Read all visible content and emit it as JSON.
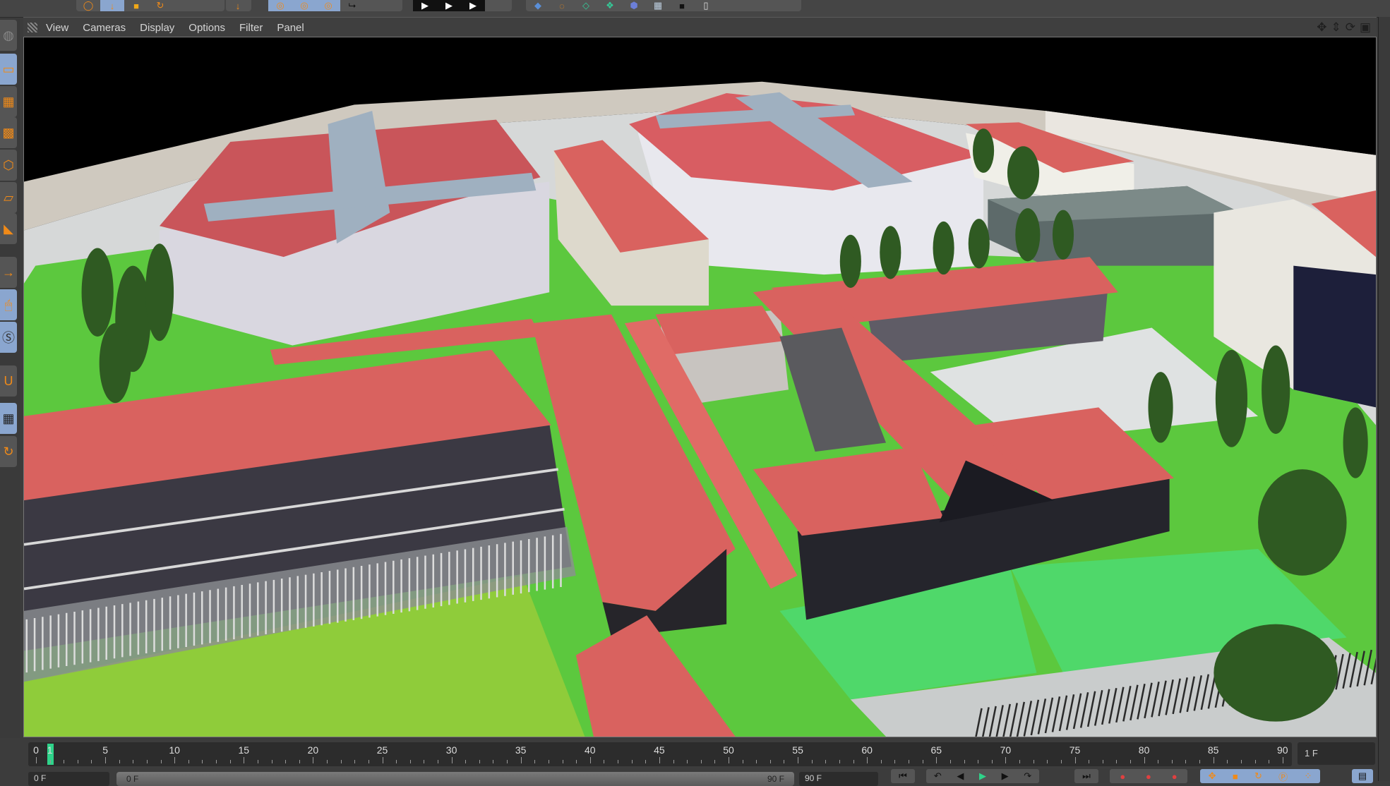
{
  "menu": {
    "items": [
      "View",
      "Cameras",
      "Display",
      "Options",
      "Filter",
      "Panel"
    ]
  },
  "viewport_nav_icons": [
    "move-icon",
    "dolly-icon",
    "rotate-icon",
    "maximize-icon"
  ],
  "timeline": {
    "labels": [
      "0",
      "1",
      "5",
      "10",
      "15",
      "20",
      "25",
      "30",
      "35",
      "40",
      "45",
      "50",
      "55",
      "60",
      "65",
      "70",
      "75",
      "80",
      "85",
      "90"
    ],
    "label_frames": [
      0,
      1,
      5,
      10,
      15,
      20,
      25,
      30,
      35,
      40,
      45,
      50,
      55,
      60,
      65,
      70,
      75,
      80,
      85,
      90
    ],
    "current_frame": 1,
    "max_frame": 90,
    "current_field": "1 F"
  },
  "range": {
    "start_field": "0 F",
    "slider_start": "0 F",
    "slider_end": "90 F",
    "end_field": "90 F"
  },
  "colors": {
    "accent": "#f08a18",
    "active": "#8aa6cf",
    "playhead": "#2fd38a",
    "roof": "#d9625f",
    "lawn": "#5cc83e"
  }
}
